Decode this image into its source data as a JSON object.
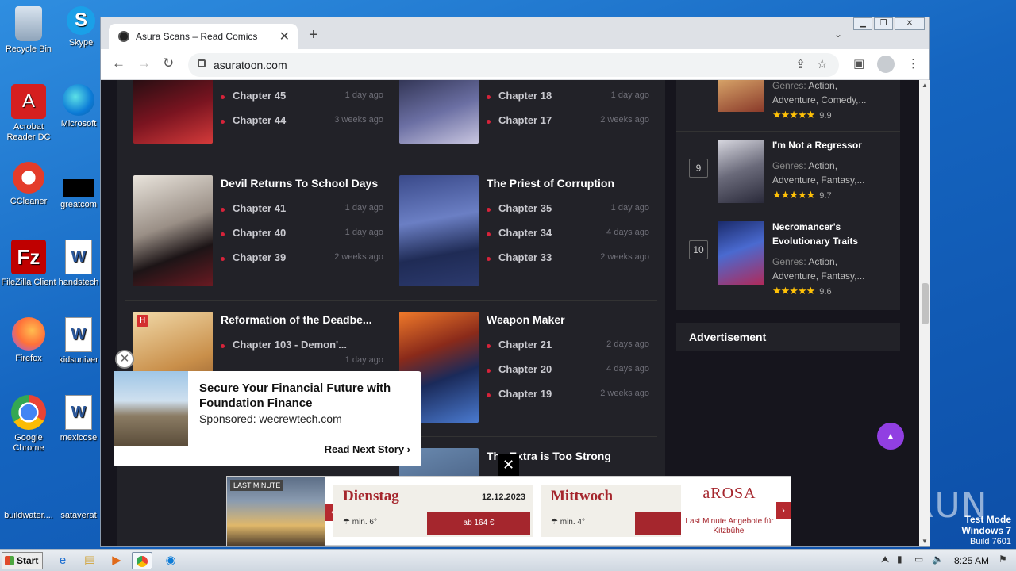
{
  "desktop": {
    "icons": [
      {
        "label": "Recycle Bin"
      },
      {
        "label": "Skype"
      },
      {
        "label": "Acrobat Reader DC"
      },
      {
        "label": "Microsoft"
      },
      {
        "label": "CCleaner"
      },
      {
        "label": "greatcom"
      },
      {
        "label": "FileZilla Client"
      },
      {
        "label": "handstech"
      },
      {
        "label": "Firefox"
      },
      {
        "label": "kidsuniver"
      },
      {
        "label": "Google Chrome"
      },
      {
        "label": "mexicose"
      },
      {
        "label": "buildwater...."
      },
      {
        "label": "sataverat"
      }
    ],
    "watermark": "ANY RUN",
    "test_mode": {
      "line1": "Test Mode",
      "line2": "Windows 7",
      "line3": "Build 7601"
    }
  },
  "browser": {
    "tab_title": "Asura Scans – Read Comics",
    "url": "asuratoon.com"
  },
  "comics": [
    {
      "title": "",
      "chapters": [
        {
          "name": "Chapter 45",
          "ago": "1 day ago"
        },
        {
          "name": "Chapter 44",
          "ago": "3 weeks ago"
        }
      ]
    },
    {
      "title": "",
      "chapters": [
        {
          "name": "Chapter 18",
          "ago": "1 day ago"
        },
        {
          "name": "Chapter 17",
          "ago": "2 weeks ago"
        }
      ]
    },
    {
      "title": "Devil Returns To School Days",
      "chapters": [
        {
          "name": "Chapter 41",
          "ago": "1 day ago"
        },
        {
          "name": "Chapter 40",
          "ago": "1 day ago"
        },
        {
          "name": "Chapter 39",
          "ago": "2 weeks ago"
        }
      ]
    },
    {
      "title": "The Priest of Corruption",
      "chapters": [
        {
          "name": "Chapter 35",
          "ago": "1 day ago"
        },
        {
          "name": "Chapter 34",
          "ago": "4 days ago"
        },
        {
          "name": "Chapter 33",
          "ago": "2 weeks ago"
        }
      ]
    },
    {
      "title": "Reformation of the Deadbe...",
      "badge": "H",
      "chapters": [
        {
          "name": "Chapter 103 - Demon'...",
          "ago": "1 day ago"
        }
      ]
    },
    {
      "title": "Weapon Maker",
      "chapters": [
        {
          "name": "Chapter 21",
          "ago": "2 days ago"
        },
        {
          "name": "Chapter 20",
          "ago": "4 days ago"
        },
        {
          "name": "Chapter 19",
          "ago": "2 weeks ago"
        }
      ]
    },
    {
      "title": "The Extra is Too Strong",
      "chapters": []
    }
  ],
  "sidebar": {
    "popular": [
      {
        "rank": "",
        "name": "",
        "genres_label": "Genres:",
        "genres_line1": "Action,",
        "genres_line2": "Adventure, Comedy,...",
        "stars": "★★★★★",
        "score": "9.9"
      },
      {
        "rank": "9",
        "name": "I'm Not a Regressor",
        "genres_label": "Genres:",
        "genres_line1": "Action,",
        "genres_line2": "Adventure, Fantasy,...",
        "stars": "★★★★★",
        "score": "9.7"
      },
      {
        "rank": "10",
        "name": "Necromancer's Evolutionary Traits",
        "genres_label": "Genres:",
        "genres_line1": "Action,",
        "genres_line2": "Adventure, Fantasy,...",
        "stars": "★★★★★",
        "score": "9.6"
      }
    ],
    "ad_heading": "Advertisement"
  },
  "popup_ad": {
    "headline": "Secure Your Financial Future with Foundation Finance",
    "sponsor": "Sponsored: wecrewtech.com",
    "next": "Read Next Story ›"
  },
  "banner_ad": {
    "badge": "LAST MINUTE",
    "day1": "Dienstag",
    "date1": "12.12.2023",
    "temp1": "min. 6°",
    "price1": "ab 164 €",
    "day2": "Mittwoch",
    "temp2": "min. 4°",
    "brand": "aROSA",
    "tagline": "Last Minute Angebote für Kitzbühel"
  },
  "taskbar": {
    "start": "Start",
    "time": "8:25 AM"
  },
  "colors": {
    "accent": "#913fe2",
    "chapter_dot": "#d6233a",
    "star": "#ffc107"
  }
}
